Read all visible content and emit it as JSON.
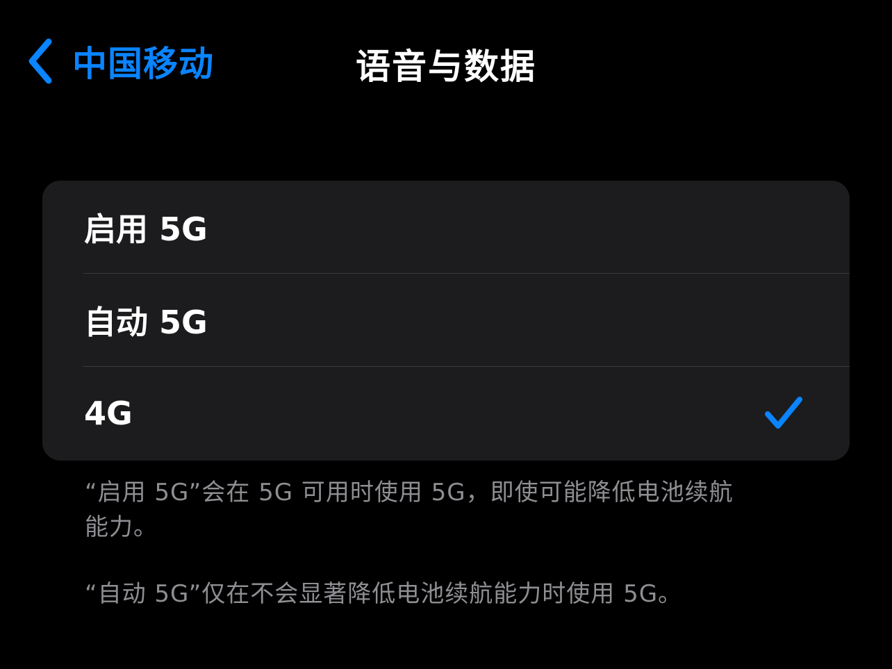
{
  "nav": {
    "back_label": "中国移动",
    "title": "语音与数据"
  },
  "options": [
    {
      "label": "启用 5G",
      "selected": false
    },
    {
      "label": "自动 5G",
      "selected": false
    },
    {
      "label": "4G",
      "selected": true
    }
  ],
  "footer": {
    "note1": "“启用 5G”会在 5G 可用时使用 5G，即使可能降低电池续航能力。",
    "note2": "“自动 5G”仅在不会显著降低电池续航能力时使用 5G。"
  },
  "colors": {
    "accent": "#0a84ff",
    "background": "#000000",
    "group_background": "#1c1c1e",
    "separator": "#3a3a3c",
    "secondary_text": "#8e8e93"
  },
  "icons": {
    "back": "chevron-left-icon",
    "selected": "checkmark-icon"
  }
}
